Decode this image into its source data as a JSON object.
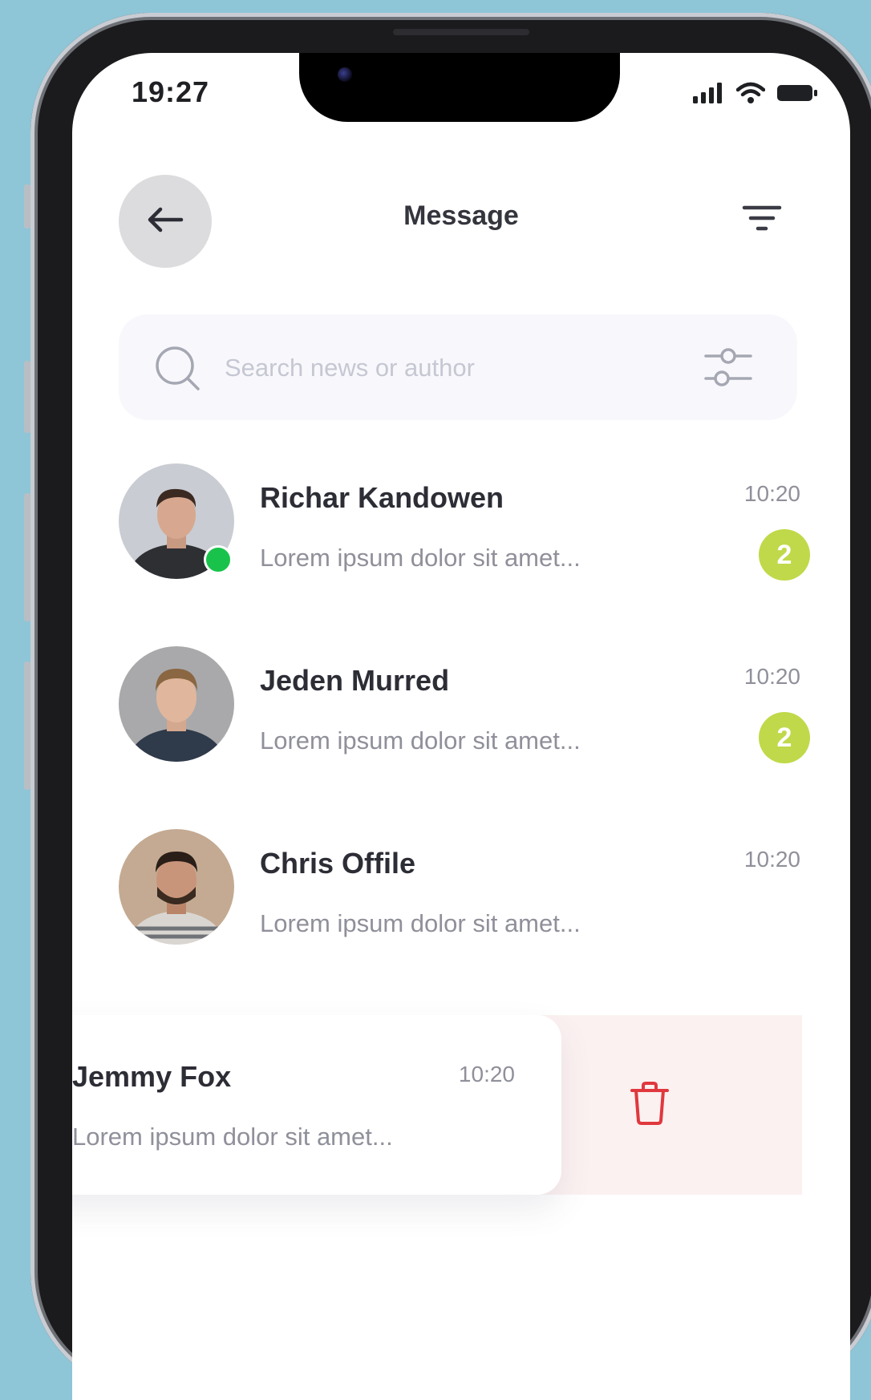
{
  "status_bar": {
    "time": "19:27",
    "signal_icon": "cellular-signal-icon",
    "wifi_icon": "wifi-icon",
    "battery_icon": "battery-icon"
  },
  "header": {
    "title": "Message",
    "back_icon": "arrow-left-icon",
    "menu_icon": "filter-lines-icon"
  },
  "search": {
    "placeholder": "Search news or author",
    "search_icon": "search-icon",
    "filter_icon": "sliders-icon"
  },
  "conversations": [
    {
      "name": "Richar Kandowen",
      "preview": "Lorem ipsum dolor sit amet...",
      "time": "10:20",
      "unread": "2",
      "online": true
    },
    {
      "name": "Jeden Murred",
      "preview": "Lorem ipsum dolor sit amet...",
      "time": "10:20",
      "unread": "2",
      "online": false
    },
    {
      "name": "Chris Offile",
      "preview": "Lorem ipsum dolor sit amet...",
      "time": "10:20",
      "unread": "",
      "online": false
    }
  ],
  "swiped_conversation": {
    "name": "Jemmy Fox",
    "preview": "Lorem ipsum dolor sit amet...",
    "time": "10:20",
    "delete_icon": "trash-icon"
  },
  "colors": {
    "background": "#8ec5d7",
    "badge": "#bfd94a",
    "online": "#19c34b",
    "delete": "#e0383e",
    "delete_bg": "#fcf1f1"
  }
}
